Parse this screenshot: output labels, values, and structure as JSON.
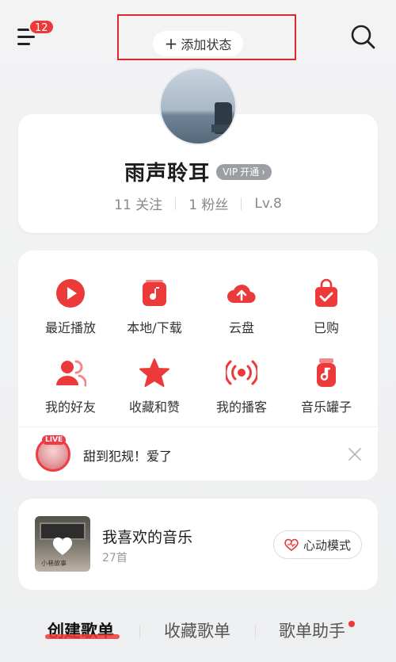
{
  "header": {
    "notification_count": "12",
    "add_status_label": "添加状态"
  },
  "profile": {
    "username": "雨声聆耳",
    "vip_label": "开通",
    "vip_mark": "VIP",
    "following": "11 关注",
    "followers": "1 粉丝",
    "level": "Lv.8"
  },
  "grid": {
    "items": [
      {
        "label": "最近播放",
        "icon": "play-icon"
      },
      {
        "label": "本地/下载",
        "icon": "music-note-icon"
      },
      {
        "label": "云盘",
        "icon": "cloud-upload-icon"
      },
      {
        "label": "已购",
        "icon": "shopping-bag-check-icon"
      },
      {
        "label": "我的好友",
        "icon": "friends-icon"
      },
      {
        "label": "收藏和赞",
        "icon": "star-icon"
      },
      {
        "label": "我的播客",
        "icon": "broadcast-icon"
      },
      {
        "label": "音乐罐子",
        "icon": "music-jar-icon"
      }
    ]
  },
  "live": {
    "badge": "LIVE",
    "text": "甜到犯规！爱了"
  },
  "liked_music": {
    "title": "我喜欢的音乐",
    "count": "27首",
    "mode_label": "心动模式",
    "cover_caption": "小巷故事"
  },
  "tabs": [
    {
      "label": "创建歌单"
    },
    {
      "label": "收藏歌单"
    },
    {
      "label": "歌单助手"
    }
  ],
  "colors": {
    "accent": "#ec3a3a",
    "background": "#f3f3f4"
  }
}
